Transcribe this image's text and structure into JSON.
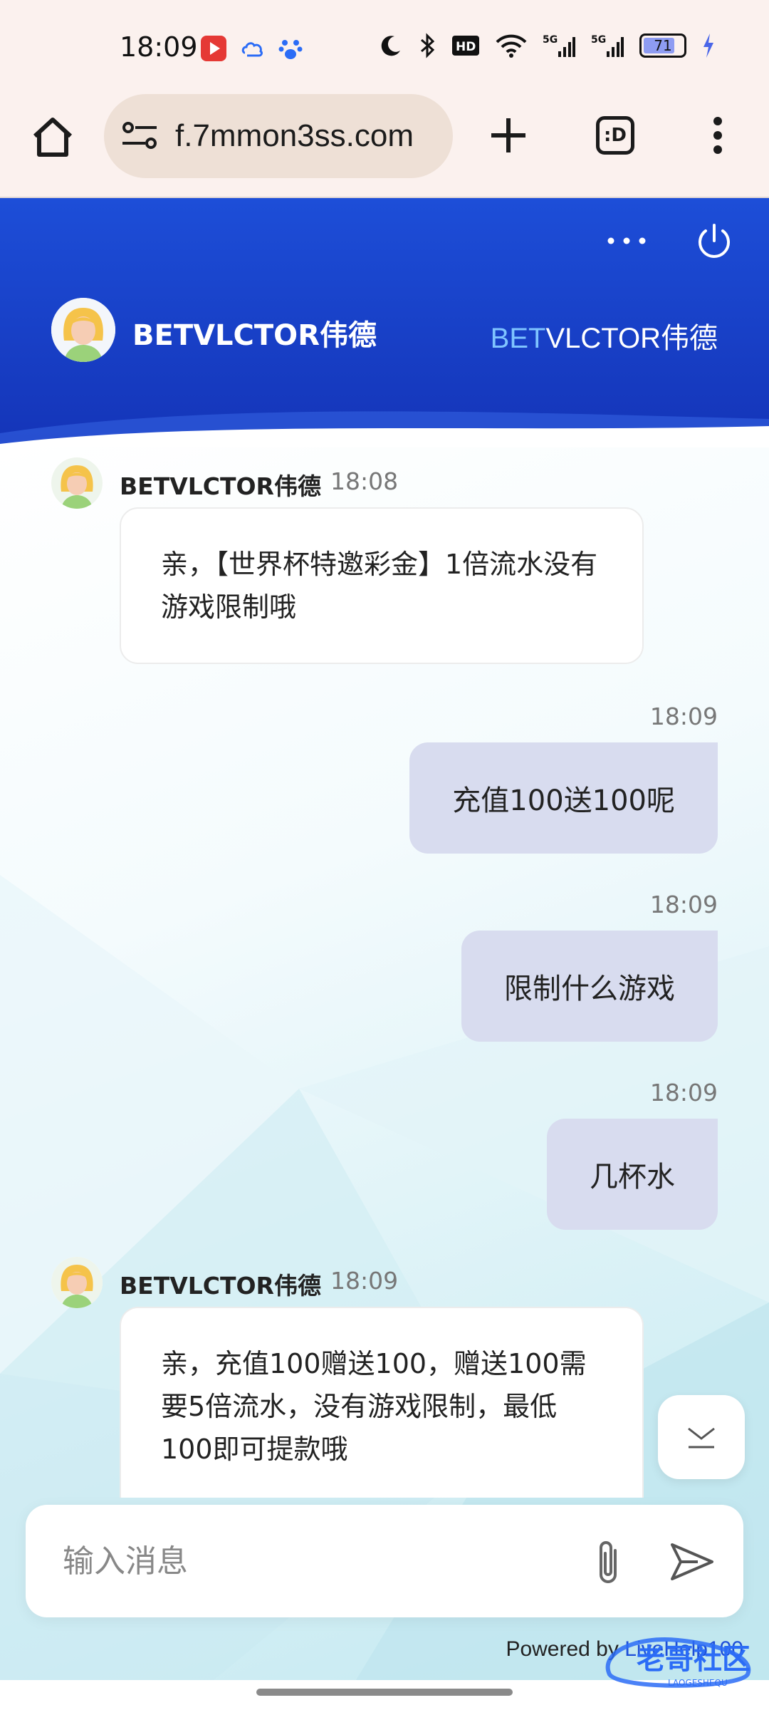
{
  "status_bar": {
    "time": "18:09",
    "battery_level": "71",
    "signal_1": "5G",
    "signal_2": "5G",
    "hd_badge": "HD"
  },
  "browser": {
    "url": "f.7mmon3ss.com",
    "tab_switcher_label": ":D"
  },
  "chat_header": {
    "agent_name": "BETVLCTOR伟德",
    "logo_prefix": "BET",
    "logo_suffix": "VLCTOR伟德"
  },
  "messages": [
    {
      "sender": "agent",
      "name": "BETVLCTOR伟德",
      "time": "18:08",
      "text": "亲，【世界杯特邀彩金】1倍流水没有游戏限制哦"
    },
    {
      "sender": "user",
      "time": "18:09",
      "text": "充值100送100呢"
    },
    {
      "sender": "user",
      "time": "18:09",
      "text": "限制什么游戏"
    },
    {
      "sender": "user",
      "time": "18:09",
      "text": "几杯水"
    },
    {
      "sender": "agent",
      "name": "BETVLCTOR伟德",
      "time": "18:09",
      "text": "亲，充值100赠送100，赠送100需要5倍流水，没有游戏限制，最低100即可提款哦"
    }
  ],
  "composer": {
    "placeholder": "输入消息"
  },
  "footer": {
    "powered_prefix": "Powered by ",
    "powered_brand": "LiveHelp100"
  },
  "watermark": {
    "text": "老哥社区",
    "sub": "LAOGESHEQU"
  },
  "colors": {
    "header_blue": "#1d4ed8",
    "user_bubble": "#d8dcef",
    "logo_accent": "#7fc4ff"
  }
}
